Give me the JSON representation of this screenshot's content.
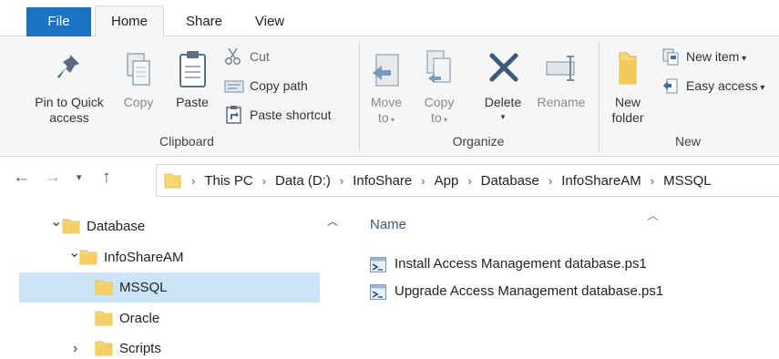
{
  "tabs": {
    "file": "File",
    "home": "Home",
    "share": "Share",
    "view": "View"
  },
  "ribbon": {
    "clipboard": {
      "pin_line1": "Pin to Quick",
      "pin_line2": "access",
      "copy": "Copy",
      "paste": "Paste",
      "cut": "Cut",
      "copy_path": "Copy path",
      "paste_shortcut": "Paste shortcut",
      "group_label": "Clipboard"
    },
    "organize": {
      "move_line1": "Move",
      "move_line2": "to",
      "copy_line1": "Copy",
      "copy_line2": "to",
      "delete": "Delete",
      "rename": "Rename",
      "group_label": "Organize"
    },
    "new": {
      "new_folder_line1": "New",
      "new_folder_line2": "folder",
      "new_item": "New item",
      "easy_access": "Easy access",
      "group_label": "New"
    }
  },
  "address": {
    "crumbs": [
      "This PC",
      "Data (D:)",
      "InfoShare",
      "App",
      "Database",
      "InfoShareAM",
      "MSSQL"
    ]
  },
  "nav_tree": [
    {
      "label": "Database",
      "expanded": true
    },
    {
      "label": "InfoShareAM",
      "expanded": true
    },
    {
      "label": "MSSQL",
      "selected": true
    },
    {
      "label": "Oracle"
    },
    {
      "label": "Scripts",
      "expanded": false
    }
  ],
  "files": {
    "column_name": "Name",
    "items": [
      {
        "name": "Install Access Management database.ps1"
      },
      {
        "name": "Upgrade Access Management database.ps1"
      }
    ]
  },
  "colors": {
    "file_tab": "#1a73c4",
    "selection": "#cce4f7",
    "ribbon_bg": "#f5f6f7",
    "folder": "#f8d775"
  }
}
